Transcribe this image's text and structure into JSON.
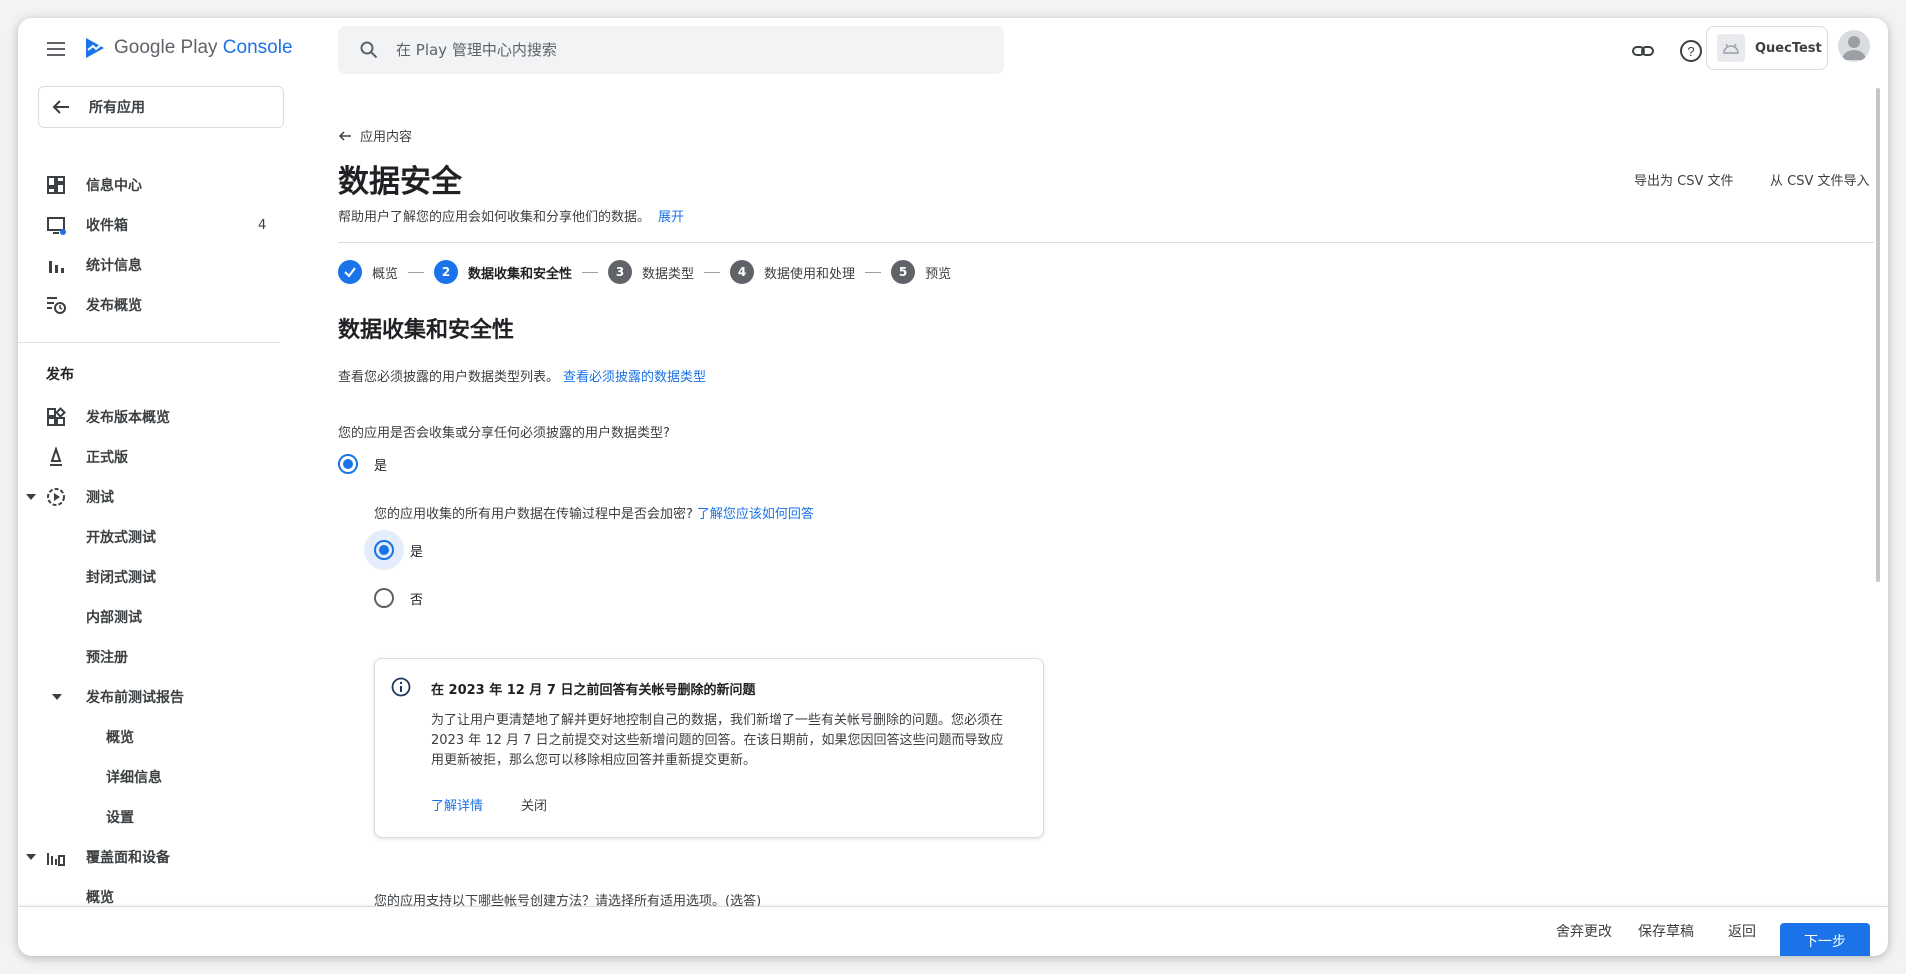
{
  "app": {
    "logo_brand": "Google Play",
    "logo_console": "Console"
  },
  "search": {
    "placeholder": "在 Play 管理中心内搜索"
  },
  "account": {
    "name": "QuecTest"
  },
  "sidebar": {
    "all_apps": "所有应用",
    "items": [
      {
        "label": "信息中心",
        "icon": "dashboard-icon"
      },
      {
        "label": "收件箱",
        "icon": "inbox-icon",
        "count": "4"
      },
      {
        "label": "统计信息",
        "icon": "bar-chart-icon"
      },
      {
        "label": "发布概览",
        "icon": "publishing-overview-icon"
      }
    ],
    "section_release": "发布",
    "release_items": [
      {
        "label": "发布版本概览",
        "icon": "release-overview-icon"
      },
      {
        "label": "正式版",
        "icon": "production-icon"
      },
      {
        "label": "测试",
        "icon": "testing-icon"
      },
      {
        "label": "开放式测试"
      },
      {
        "label": "封闭式测试"
      },
      {
        "label": "内部测试"
      },
      {
        "label": "预注册"
      },
      {
        "label": "发布前测试报告"
      },
      {
        "label": "概览"
      },
      {
        "label": "详细信息"
      },
      {
        "label": "设置"
      },
      {
        "label": "覆盖面和设备",
        "icon": "reach-devices-icon"
      },
      {
        "label": "概览"
      }
    ]
  },
  "main": {
    "back_label": "应用内容",
    "title": "数据安全",
    "desc": "帮助用户了解您的应用会如何收集和分享他们的数据。",
    "desc_link": "展开",
    "export_csv": "导出为 CSV 文件",
    "import_csv": "从 CSV 文件导入",
    "steps": [
      {
        "num": "1",
        "label": "概览",
        "state": "done"
      },
      {
        "num": "2",
        "label": "数据收集和安全性",
        "state": "active"
      },
      {
        "num": "3",
        "label": "数据类型",
        "state": "pending"
      },
      {
        "num": "4",
        "label": "数据使用和处理",
        "state": "pending"
      },
      {
        "num": "5",
        "label": "预览",
        "state": "pending"
      }
    ],
    "section_title": "数据收集和安全性",
    "intro_text": "查看您必须披露的用户数据类型列表。",
    "intro_link": "查看必须披露的数据类型",
    "question1": "您的应用是否会收集或分享任何必须披露的用户数据类型?",
    "q1_answer": "是",
    "question2": "您的应用收集的所有用户数据在传输过程中是否会加密?",
    "question2_link": "了解您应该如何回答",
    "q2_yes": "是",
    "q2_no": "否",
    "notice": {
      "title": "在 2023 年 12 月 7 日之前回答有关帐号删除的新问题",
      "body": "为了让用户更清楚地了解并更好地控制自己的数据，我们新增了一些有关帐号删除的问题。您必须在 2023 年 12 月 7 日之前提交对这些新增问题的回答。在该日期前，如果您因回答这些问题而导致应用更新被拒，那么您可以移除相应回答并重新提交更新。",
      "learn_more": "了解详情",
      "close": "关闭"
    },
    "question3": "您的应用支持以下哪些帐号创建方法？请选择所有适用选项。(选答)"
  },
  "footer": {
    "discard": "舍弃更改",
    "save_draft": "保存草稿",
    "back": "返回",
    "next": "下一步"
  },
  "colors": {
    "accent": "#1a73e8",
    "text": "#202124",
    "muted": "#3c4043"
  }
}
